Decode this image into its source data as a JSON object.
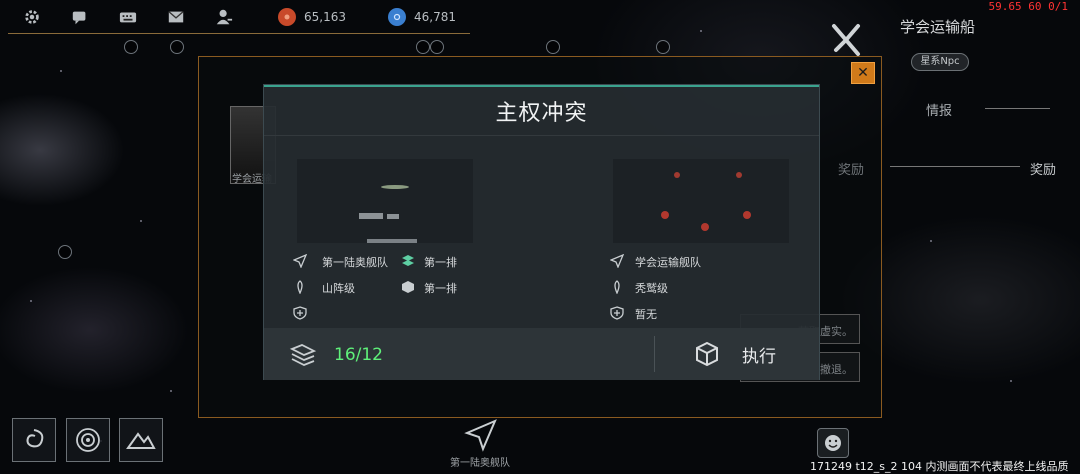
{
  "top_bar": {
    "icons": [
      "gear-icon",
      "chat-icon",
      "keyboard-icon",
      "mail-icon",
      "profile-icon"
    ],
    "resource_1": {
      "value": "65,163",
      "color": "#c84a2a"
    },
    "resource_2": {
      "value": "46,781",
      "color": "#3a7fd0"
    }
  },
  "debug": {
    "fps": "59.65 60 0/1",
    "build_info": "171249 t12_s_2 104  内测画面不代表最终上线品质"
  },
  "side_panel": {
    "title": "学会运输船",
    "badge": "星系Npc",
    "tab_info": "情报",
    "tab_reward": "奖励",
    "close_label": "✕"
  },
  "background_panel": {
    "avatar_label": "学会运输",
    "reward_label": "奖励",
    "option_1": "获取虚实。",
    "option_2": "暂时撤退。"
  },
  "dialog": {
    "title": "主权冲突",
    "left": {
      "fleet_name": "第一陆奥舰队",
      "formation": "第一排",
      "ship_class": "山阵级",
      "defense_slot": "第一排"
    },
    "right": {
      "fleet_name": "学会运输舰队",
      "ship_class": "秃鹫级",
      "status": "暂无"
    },
    "count": "16/12",
    "execute_label": "执行",
    "accent_color": "#3aa38e",
    "count_color": "#5ff07a"
  },
  "bottom": {
    "fleet_label": "第一陆奥舰队",
    "buttons": [
      "galaxy-icon",
      "orbit-icon",
      "terrain-icon"
    ]
  }
}
